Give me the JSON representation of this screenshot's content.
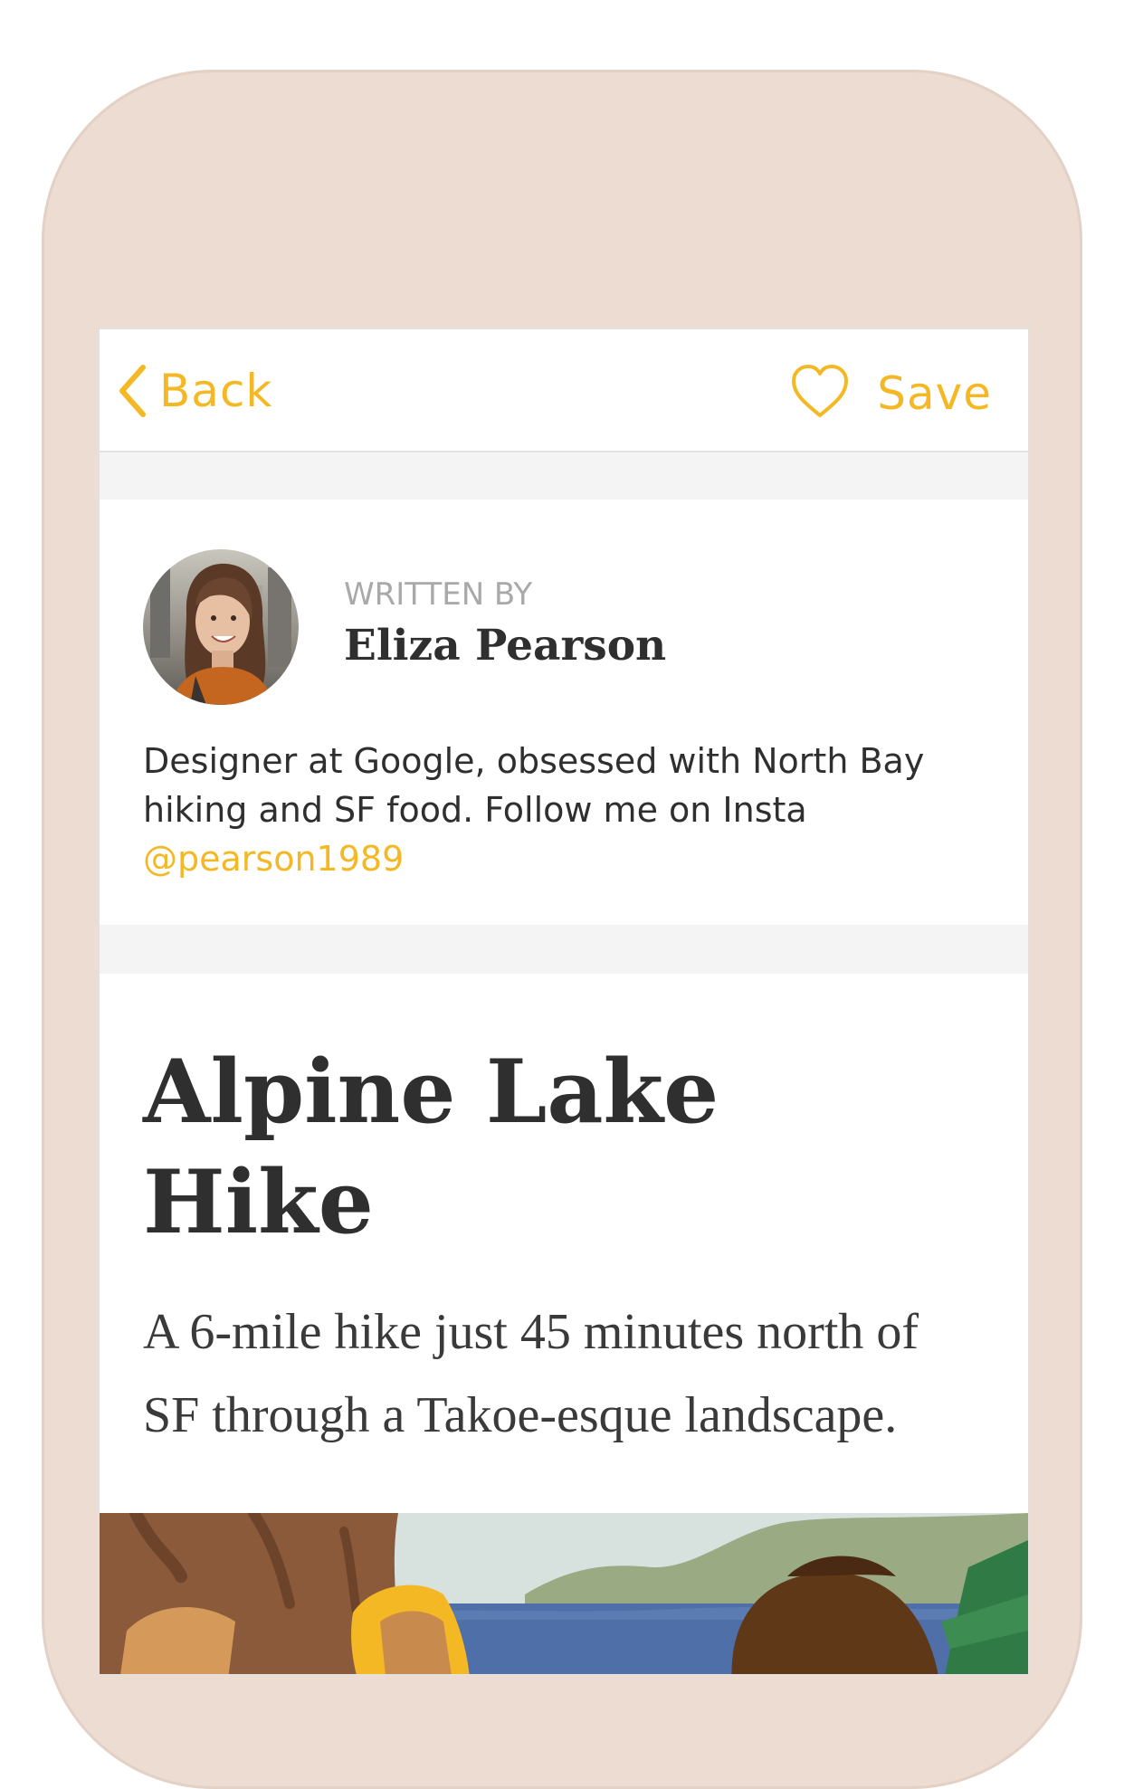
{
  "nav": {
    "back_label": "Back",
    "save_label": "Save",
    "accent_color": "#f3b824"
  },
  "author": {
    "written_by_label": "WRITTEN BY",
    "name": "Eliza Pearson",
    "bio_text": "Designer at Google, obsessed with North Bay hiking and SF food. Follow me on Insta",
    "insta_handle": "@pearson1989"
  },
  "article": {
    "title_line1": "Alpine Lake",
    "title_line2": "Hike",
    "subtitle": "A 6-mile hike just 45 minutes north of SF through a Takoe-esque landscape."
  },
  "icons": {
    "back": "chevron-left-icon",
    "save": "heart-outline-icon"
  }
}
